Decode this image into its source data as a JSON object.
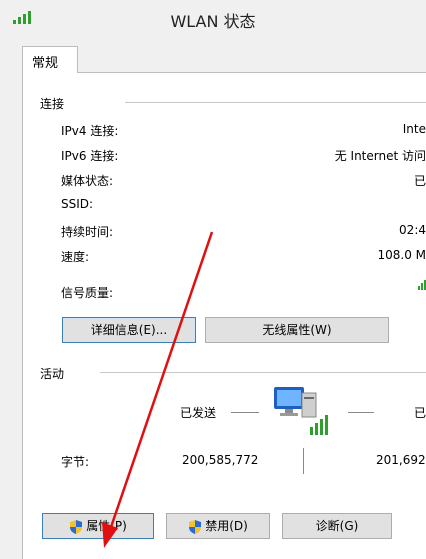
{
  "window": {
    "title": "WLAN 状态"
  },
  "tabs": [
    {
      "label": "常规"
    }
  ],
  "connection": {
    "section_label": "连接",
    "rows": [
      {
        "label": "IPv4 连接:",
        "value": "Inte"
      },
      {
        "label": "IPv6 连接:",
        "value": "无 Internet 访问"
      },
      {
        "label": "媒体状态:",
        "value": "已"
      },
      {
        "label": "SSID:",
        "value": ""
      },
      {
        "label": "持续时间:",
        "value": "02:4"
      },
      {
        "label": "速度:",
        "value": "108.0 M"
      },
      {
        "label": "信号质量:",
        "value": ""
      }
    ],
    "details_button": "详细信息(E)...",
    "wireless_props_button": "无线属性(W)"
  },
  "activity": {
    "section_label": "活动",
    "sent_label": "已发送",
    "received_label": "已",
    "bytes_label": "字节:",
    "bytes_sent": "200,585,772",
    "bytes_received": "201,692"
  },
  "buttons": {
    "properties": "属性(P)",
    "disable": "禁用(D)",
    "diagnose": "诊断(G)"
  },
  "colors": {
    "accent": "#3c7fb1",
    "signal_green": "#2f9e2f",
    "annotation_red": "#e01010"
  }
}
